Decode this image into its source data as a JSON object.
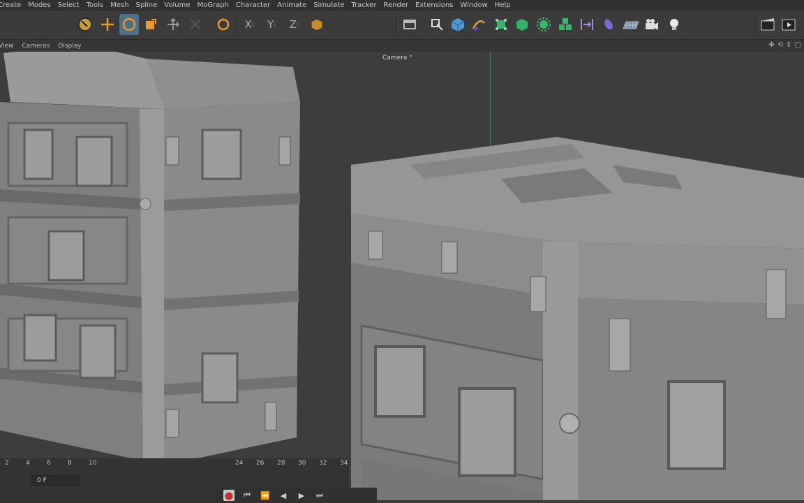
{
  "menu": [
    "Create",
    "Modes",
    "Select",
    "Tools",
    "Mesh",
    "Spline",
    "Volume",
    "MoGraph",
    "Character",
    "Animate",
    "Simulate",
    "Tracker",
    "Render",
    "Extensions",
    "Window",
    "Help"
  ],
  "toolbar": {
    "tools_left": [
      {
        "name": "live-selection-icon",
        "glyph": "◉",
        "active": false
      },
      {
        "name": "move-icon",
        "glyph": "✛",
        "active": false
      },
      {
        "name": "rotate-icon",
        "glyph": "↻",
        "active": true
      },
      {
        "name": "scale-icon",
        "glyph": "■",
        "active": false
      },
      {
        "name": "transform-icon",
        "glyph": "✥",
        "active": false
      },
      {
        "name": "dim-tool-icon",
        "glyph": "✦",
        "active": false
      },
      {
        "name": "undo-rotate-icon",
        "glyph": "↻",
        "active": false
      }
    ],
    "axis_x": "X",
    "axis_y": "Y",
    "axis_z": "Z",
    "tools_right": [
      {
        "name": "render-region-icon",
        "glyph": "▭"
      },
      {
        "name": "pen-icon",
        "glyph": "✎"
      },
      {
        "name": "cube-icon",
        "glyph": "◆"
      },
      {
        "name": "spline-pen-icon",
        "glyph": "✒"
      },
      {
        "name": "subdivision-icon",
        "glyph": "⬢"
      },
      {
        "name": "extrude-icon",
        "glyph": "⬡"
      },
      {
        "name": "cloner-icon",
        "glyph": "✺"
      },
      {
        "name": "mograph-icon",
        "glyph": "❖"
      },
      {
        "name": "deformer-icon",
        "glyph": "⇹"
      },
      {
        "name": "field-icon",
        "glyph": "⬮"
      },
      {
        "name": "floor-icon",
        "glyph": "▦"
      },
      {
        "name": "camera-icon",
        "glyph": "▣"
      },
      {
        "name": "light-icon",
        "glyph": "💡"
      }
    ],
    "render_icons": [
      {
        "name": "render-view-icon",
        "glyph": "▤"
      },
      {
        "name": "render-picture-viewer-icon",
        "glyph": "▶"
      }
    ]
  },
  "viewport_menu": [
    "View",
    "Cameras",
    "Display"
  ],
  "viewport": {
    "camera_label": "Camera",
    "camera_suffix": "°"
  },
  "timeline": {
    "ticks": [
      "2",
      "4",
      "6",
      "8",
      "10",
      "24",
      "26",
      "28",
      "30",
      "32",
      "34"
    ],
    "current_frame": "0 F"
  },
  "playback": [
    {
      "name": "record-icon",
      "glyph": "⬤"
    },
    {
      "name": "go-to-start-icon",
      "glyph": "⏮"
    },
    {
      "name": "prev-key-icon",
      "glyph": "⏪"
    },
    {
      "name": "prev-frame-icon",
      "glyph": "◀"
    },
    {
      "name": "play-icon",
      "glyph": "▶"
    },
    {
      "name": "go-to-end-icon",
      "glyph": "⏭"
    }
  ],
  "colors": {
    "accent_active": "#4f6e8a",
    "axis_green": "#3c7a4f",
    "model_gray": "#8a8a8a"
  }
}
